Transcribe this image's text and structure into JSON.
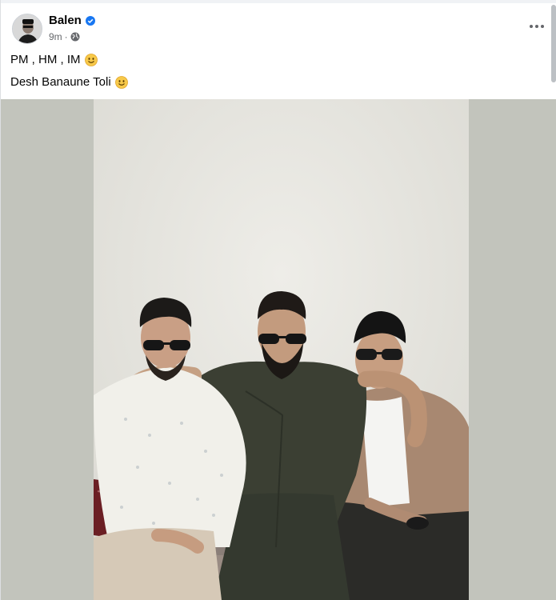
{
  "post": {
    "author": "Balen",
    "time": "9m",
    "separator": "·",
    "lines": [
      "PM , HM , IM",
      "Desh Banaune Toli"
    ]
  },
  "icons": {
    "verified": "verified-badge-icon",
    "audience": "globe-icon",
    "emoji": "smiling-face-emoji",
    "menu": "more-options-icon"
  },
  "colors": {
    "verified": "#1877f2",
    "secondary_text": "#65676b",
    "photo_backdrop": "#c2c4bc"
  }
}
